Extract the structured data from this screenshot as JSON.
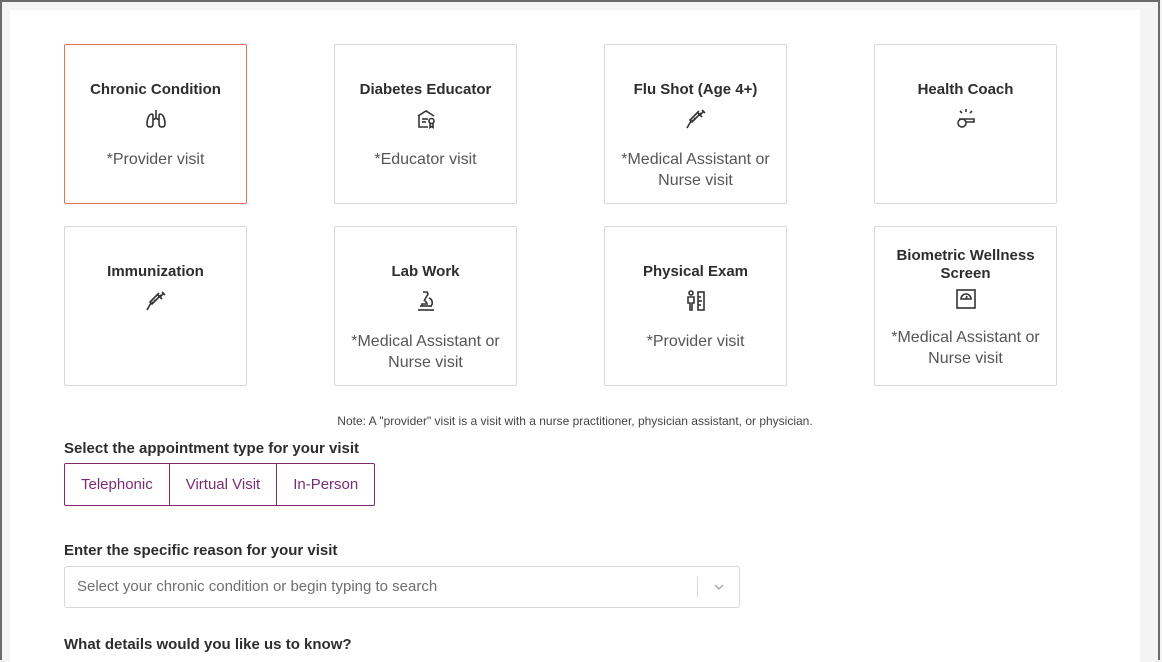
{
  "cards": [
    {
      "title": "Chronic Condition",
      "icon": "lungs-icon",
      "sub": "*Provider visit"
    },
    {
      "title": "Diabetes Educator",
      "icon": "certificate-icon",
      "sub": "*Educator visit"
    },
    {
      "title": "Flu Shot (Age 4+)",
      "icon": "syringe-icon",
      "sub": "*Medical Assistant or Nurse visit"
    },
    {
      "title": "Health Coach",
      "icon": "whistle-icon",
      "sub": ""
    },
    {
      "title": "Immunization",
      "icon": "syringe-icon",
      "sub": ""
    },
    {
      "title": "Lab Work",
      "icon": "microscope-icon",
      "sub": "*Medical Assistant or Nurse visit"
    },
    {
      "title": "Physical Exam",
      "icon": "physical-exam-icon",
      "sub": "*Provider visit"
    },
    {
      "title": "Biometric Wellness Screen",
      "icon": "scale-icon",
      "sub": "*Medical Assistant or Nurse visit"
    }
  ],
  "note": "Note: A \"provider\" visit is a visit with a nurse practitioner, physician assistant, or physician.",
  "appointment": {
    "label": "Select the appointment type for your visit",
    "options": [
      "Telephonic",
      "Virtual Visit",
      "In-Person"
    ]
  },
  "reason": {
    "label": "Enter the specific reason for your visit",
    "placeholder": "Select your chronic condition or begin typing to search"
  },
  "details": {
    "label": "What details would you like us to know?"
  },
  "colors": {
    "selected_border": "#e5735a",
    "accent": "#7a2b72"
  }
}
